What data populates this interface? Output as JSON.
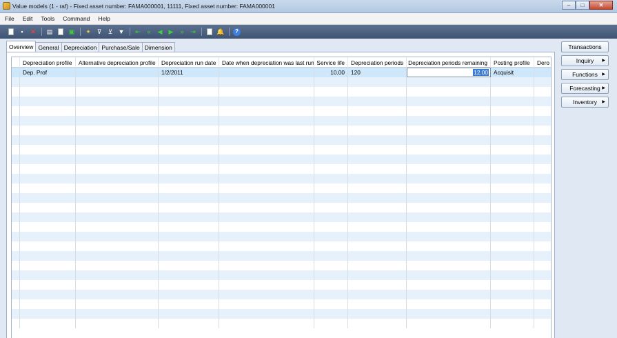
{
  "window": {
    "title": "Value models (1 - raf) - Fixed asset number: FAMA000001, 11111, Fixed asset number: FAMA000001",
    "minimize": "–",
    "maximize": "□",
    "close": "✕"
  },
  "menu": [
    "File",
    "Edit",
    "Tools",
    "Command",
    "Help"
  ],
  "toolbar": [
    {
      "icon": "new-icon",
      "glyph": ""
    },
    {
      "icon": "save-icon",
      "glyph": "▪"
    },
    {
      "icon": "delete-icon",
      "glyph": "✕"
    },
    {
      "icon": "print-icon",
      "glyph": "▤"
    },
    {
      "icon": "print-preview-icon",
      "glyph": ""
    },
    {
      "icon": "export-excel-icon",
      "glyph": "▣"
    },
    {
      "icon": "filter-selection-icon",
      "glyph": "✦"
    },
    {
      "icon": "filter-by-grid-icon",
      "glyph": "⊽"
    },
    {
      "icon": "advanced-filter-icon",
      "glyph": "⊻"
    },
    {
      "icon": "filter-icon",
      "glyph": "▼"
    },
    {
      "icon": "first-record-icon",
      "glyph": "⇤"
    },
    {
      "icon": "previous-page-icon",
      "glyph": "«"
    },
    {
      "icon": "previous-record-icon",
      "glyph": "◀"
    },
    {
      "icon": "next-record-icon",
      "glyph": "▶"
    },
    {
      "icon": "next-page-icon",
      "glyph": "»"
    },
    {
      "icon": "last-record-icon",
      "glyph": "⇥"
    },
    {
      "icon": "document-handling-icon",
      "glyph": ""
    },
    {
      "icon": "alert-icon",
      "glyph": "🔔"
    },
    {
      "icon": "help-icon",
      "glyph": "?"
    }
  ],
  "tabs": [
    "Overview",
    "General",
    "Depreciation",
    "Purchase/Sale",
    "Dimension"
  ],
  "grid": {
    "columns": [
      "",
      "Depreciation profile",
      "Alternative depreciation profile",
      "Depreciation run date",
      "Date when depreciation was last run",
      "Service life",
      "Depreciation periods",
      "Depreciation periods remaining",
      "Posting profile",
      "Dero"
    ],
    "rows": [
      [
        "",
        "Dep. Prof",
        "",
        "1/2/2011",
        "",
        "10.00",
        "120",
        "12.00",
        "Acquisit",
        ""
      ]
    ],
    "empty_rows": 26
  },
  "side_buttons": [
    {
      "label": "Transactions",
      "menu": false
    },
    {
      "label": "Inquiry",
      "menu": true
    },
    {
      "label": "Functions",
      "menu": true
    },
    {
      "label": "Forecasting",
      "menu": true
    },
    {
      "label": "Inventory",
      "menu": true
    }
  ],
  "colors": {
    "toolbar": "#4a5e7d",
    "selected_row": "#cfe7fa",
    "alt_row": "#e7f1fb"
  }
}
